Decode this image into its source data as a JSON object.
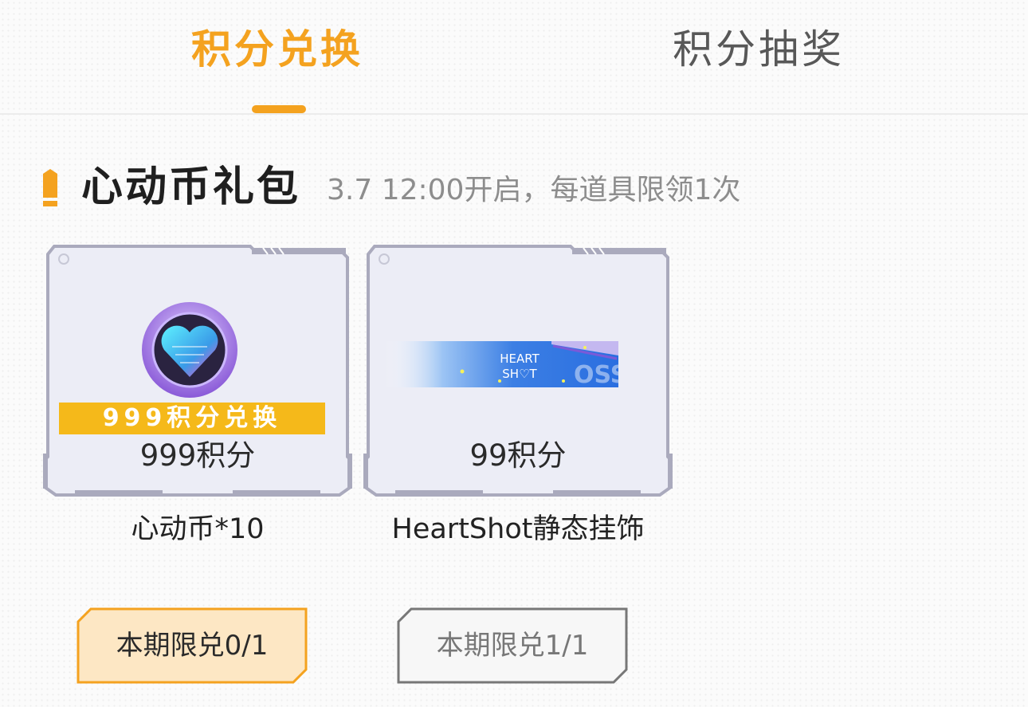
{
  "tabs": [
    {
      "label": "积分兑换",
      "active": true
    },
    {
      "label": "积分抽奖",
      "active": false
    }
  ],
  "section": {
    "title": "心动币礼包",
    "note": "3.7 12:00开启，每道具限领1次"
  },
  "items": [
    {
      "ribbon": "999积分兑换",
      "price": "999积分",
      "name": "心动币*10",
      "limit": "本期限兑0/1",
      "limit_state": "available",
      "icon": "heart-coin-icon"
    },
    {
      "banner_text_line1": "HEART",
      "banner_text_line2": "SH♡T",
      "price": "99积分",
      "name": "HeartShot静态挂饰",
      "limit": "本期限兑1/1",
      "limit_state": "exhausted",
      "icon": "heartshot-banner-image"
    }
  ],
  "colors": {
    "accent": "#f4a21f",
    "ribbon": "#f5b91a",
    "available_bg": "#fde7c4",
    "exhausted_border": "#777777"
  }
}
